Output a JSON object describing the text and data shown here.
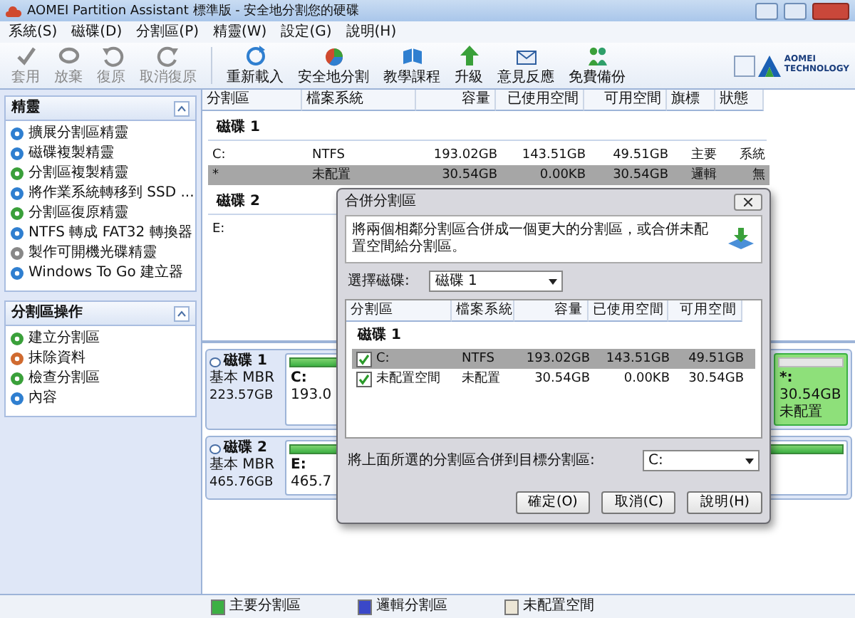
{
  "window": {
    "title": "AOMEI Partition Assistant 標準版 - 安全地分割您的硬碟"
  },
  "menu": [
    "系統(S)",
    "磁碟(D)",
    "分割區(P)",
    "精靈(W)",
    "設定(G)",
    "說明(H)"
  ],
  "toolbar": [
    {
      "label": "套用",
      "disabled": true
    },
    {
      "label": "放棄",
      "disabled": true
    },
    {
      "label": "復原",
      "disabled": true
    },
    {
      "label": "取消復原",
      "disabled": true
    },
    {
      "label": "重新載入",
      "disabled": false
    },
    {
      "label": "安全地分割",
      "disabled": false
    },
    {
      "label": "教學課程",
      "disabled": false
    },
    {
      "label": "升級",
      "disabled": false
    },
    {
      "label": "意見反應",
      "disabled": false
    },
    {
      "label": "免費備份",
      "disabled": false
    }
  ],
  "logo": {
    "name": "AOMEI",
    "tagline": "TECHNOLOGY"
  },
  "sidebar": [
    {
      "title": "精靈",
      "items": [
        "擴展分割區精靈",
        "磁碟複製精靈",
        "分割區複製精靈",
        "將作業系統轉移到 SSD ...",
        "分割區復原精靈",
        "NTFS 轉成 FAT32 轉換器",
        "製作可開機光碟精靈",
        "Windows To Go 建立器"
      ]
    },
    {
      "title": "分割區操作",
      "items": [
        "建立分割區",
        "抹除資料",
        "檢查分割區",
        "內容"
      ]
    }
  ],
  "table": {
    "columns": [
      "分割區",
      "檔案系統",
      "容量",
      "已使用空間",
      "可用空間",
      "旗標",
      "狀態"
    ],
    "groups": [
      {
        "title": "磁碟 1",
        "rows": [
          {
            "cells": [
              "C:",
              "NTFS",
              "193.02GB",
              "143.51GB",
              "49.51GB",
              "主要",
              "系統"
            ],
            "selected": false
          },
          {
            "cells": [
              "*",
              "未配置",
              "30.54GB",
              "0.00KB",
              "30.54GB",
              "邏輯",
              "無"
            ],
            "selected": true
          }
        ]
      },
      {
        "title": "磁碟 2",
        "rows": [
          {
            "cells": [
              "E:"
            ],
            "selected": false
          }
        ]
      }
    ]
  },
  "disk_map": [
    {
      "name": "磁碟 1",
      "type": "基本 MBR",
      "size": "223.57GB",
      "partitions": [
        {
          "label": "C:",
          "detail": "193.0",
          "selected": false,
          "kind": "wide"
        },
        {
          "label": "*:",
          "detail": "30.54GB 未配置",
          "selected": true,
          "kind": "narrow"
        }
      ]
    },
    {
      "name": "磁碟 2",
      "type": "基本 MBR",
      "size": "465.76GB",
      "partitions": [
        {
          "label": "E:",
          "detail": "465.7",
          "selected": false,
          "kind": "wide"
        }
      ]
    }
  ],
  "legend": [
    {
      "label": "主要分割區",
      "color": "#3cb043"
    },
    {
      "label": "邏輯分割區",
      "color": "#3a48c8"
    },
    {
      "label": "未配置空間",
      "color": "#ece6d6"
    }
  ],
  "dialog": {
    "title": "合併分割區",
    "description": "將兩個相鄰分割區合併成一個更大的分割區，或合併未配置空間給分割區。",
    "disk_label": "選擇磁碟:",
    "disk_value": "磁碟 1",
    "columns": [
      "分割區",
      "檔案系統",
      "容量",
      "已使用空間",
      "可用空間"
    ],
    "group": "磁碟 1",
    "rows": [
      {
        "cells": [
          "C:",
          "NTFS",
          "193.02GB",
          "143.51GB",
          "49.51GB"
        ],
        "checked": true,
        "selected": true
      },
      {
        "cells": [
          "未配置空間",
          "未配置",
          "30.54GB",
          "0.00KB",
          "30.54GB"
        ],
        "checked": true,
        "selected": false
      }
    ],
    "target_label": "將上面所選的分割區合併到目標分割區:",
    "target_value": "C:",
    "buttons": [
      "確定(O)",
      "取消(C)",
      "說明(H)"
    ]
  }
}
